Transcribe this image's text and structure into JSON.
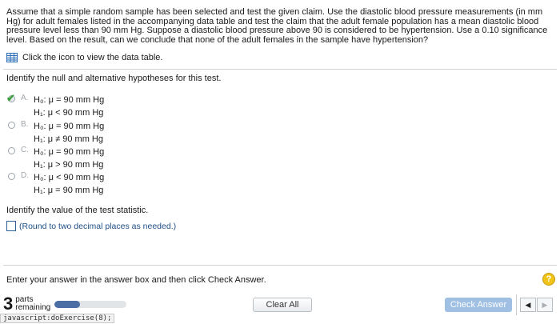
{
  "problem": {
    "text": "Assume that a simple random sample has been selected and test the given claim. Use the diastolic blood pressure measurements (in mm Hg) for adult females listed in the accompanying data table and test the claim that the adult female population has a mean diastolic blood pressure level less than 90 mm Hg. Suppose a diastolic blood pressure above 90 is considered to be hypertension. Use a 0.10 significance level. Based on the result, can we conclude that none of the adult females in the sample have hypertension?"
  },
  "data_link": {
    "label": "Click the icon to view the data table."
  },
  "question1": {
    "text": "Identify the null and alternative hypotheses for this test."
  },
  "options": [
    {
      "letter": "A.",
      "h0": "H₀: μ = 90 mm Hg",
      "h1": "H₁: μ < 90 mm Hg",
      "selected": true
    },
    {
      "letter": "B.",
      "h0": "H₀: μ = 90 mm Hg",
      "h1": "H₁: μ ≠ 90 mm Hg",
      "selected": false
    },
    {
      "letter": "C.",
      "h0": "H₀: μ = 90 mm Hg",
      "h1": "H₁: μ > 90 mm Hg",
      "selected": false
    },
    {
      "letter": "D.",
      "h0": "H₀: μ < 90 mm Hg",
      "h1": "H₁: μ = 90 mm Hg",
      "selected": false
    }
  ],
  "question2": {
    "text": "Identify the value of the test statistic."
  },
  "answer": {
    "value": "",
    "hint": "(Round to two decimal places as needed.)"
  },
  "instructions": {
    "text": "Enter your answer in the answer box and then click Check Answer."
  },
  "help": {
    "label": "?"
  },
  "parts": {
    "count": "3",
    "label_line1": "parts",
    "label_line2": "remaining",
    "progress": 0.35
  },
  "buttons": {
    "clear": "Clear All",
    "check": "Check Answer",
    "prev": "◀",
    "next": "▶"
  },
  "status_bar": {
    "text": "javascript:doExercise(8);"
  },
  "colors": {
    "accent": "#4b6fa5",
    "check_button": "#9fbfe3",
    "link": "#1f4f86",
    "correct": "#3aa13a",
    "help": "#f0c419"
  }
}
